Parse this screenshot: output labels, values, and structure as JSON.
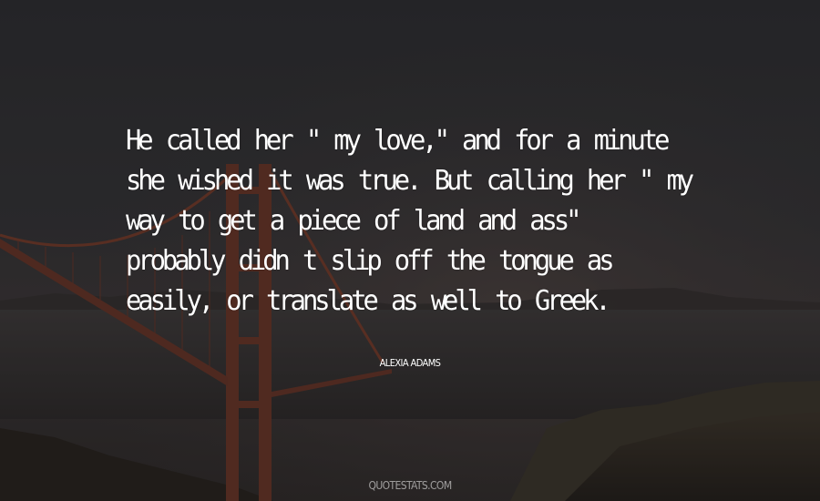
{
  "quote": {
    "lines": [
      "He called her \" my love,\" and for a minute",
      "she wished it was true. But calling her \" my",
      "way to get a piece of land and ass\"",
      "probably didn t slip off the tongue as",
      "easily, or translate as well to Greek."
    ]
  },
  "author": "Alexia Adams",
  "watermark": "QUOTESTATS.COM",
  "colors": {
    "sky_top": "#2d2d30",
    "sky_bottom": "#3a3230",
    "bridge": "#7a3a26",
    "text": "#ffffff"
  }
}
